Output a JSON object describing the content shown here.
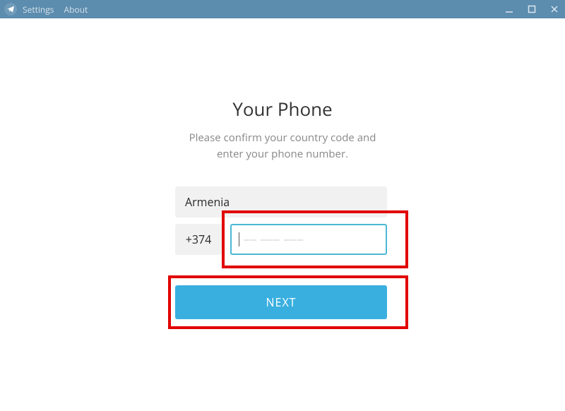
{
  "titlebar": {
    "settings": "Settings",
    "about": "About"
  },
  "heading": "Your Phone",
  "subheading_line1": "Please confirm your country code and",
  "subheading_line2": "enter your phone number.",
  "country": "Armenia",
  "dial_code": "+374",
  "phone_placeholder": "–– ––– –––",
  "next_label": "NEXT"
}
